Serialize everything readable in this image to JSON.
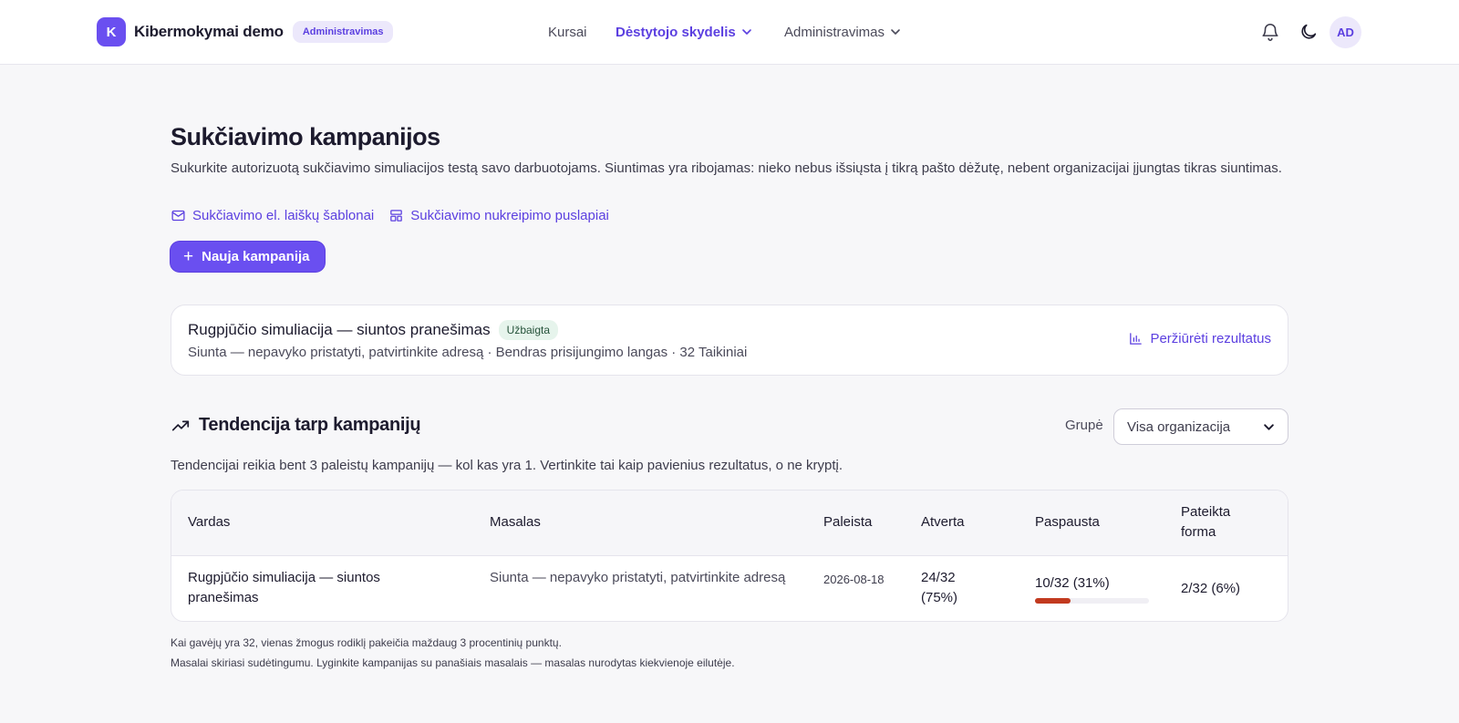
{
  "header": {
    "brand_initial": "K",
    "brand_name": "Kibermokymai demo",
    "brand_badge": "Administravimas",
    "nav_courses": "Kursai",
    "nav_teacher": "Dėstytojo skydelis",
    "nav_admin": "Administravimas",
    "avatar_initials": "AD"
  },
  "page": {
    "title": "Sukčiavimo kampanijos",
    "description": "Sukurkite autorizuotą sukčiavimo simuliacijos testą savo darbuotojams. Siuntimas yra ribojamas: nieko nebus išsiųsta į tikrą pašto dėžutę, nebent organizacijai įjungtas tikras siuntimas.",
    "link_templates": "Sukčiavimo el. laiškų šablonai",
    "link_landing": "Sukčiavimo nukreipimo puslapiai",
    "new_campaign": "Nauja kampanija"
  },
  "campaign": {
    "title": "Rugpjūčio simuliacija — siuntos pranešimas",
    "status": "Užbaigta",
    "subtitle": "Siunta — nepavyko pristatyti, patvirtinkite adresą · Bendras prisijungimo langas · 32 Taikiniai",
    "results_link": "Peržiūrėti rezultatus"
  },
  "trend": {
    "title": "Tendencija tarp kampanijų",
    "group_label": "Grupė",
    "group_value": "Visa organizacija",
    "note": "Tendencijai reikia bent 3 paleistų kampanijų — kol kas yra 1. Vertinkite tai kaip pavienius rezultatus, o ne kryptį."
  },
  "table": {
    "columns": [
      "Vardas",
      "Masalas",
      "Paleista",
      "Atverta",
      "Paspausta",
      "Pateikta forma"
    ],
    "rows": [
      {
        "name": "Rugpjūčio simuliacija — siuntos pranešimas",
        "lure": "Siunta — nepavyko pristatyti, patvirtinkite adresą",
        "launched": "2026-08-18",
        "opened": "24/32 (75%)",
        "clicked": "10/32 (31%)",
        "clicked_fraction": 0.31,
        "submitted": "2/32 (6%)"
      }
    ]
  },
  "footnotes": [
    "Kai gavėjų yra 32, vienas žmogus rodiklį pakeičia maždaug 3 procentinių punktų.",
    "Masalai skiriasi sudėtingumu. Lyginkite kampanijas su panašiais masalais — masalas nurodytas kiekvienoje eilutėje."
  ],
  "colors": {
    "accent": "#6a4ff0",
    "danger_bar": "#c23a1f",
    "success_badge_bg": "#e6f4ec"
  }
}
